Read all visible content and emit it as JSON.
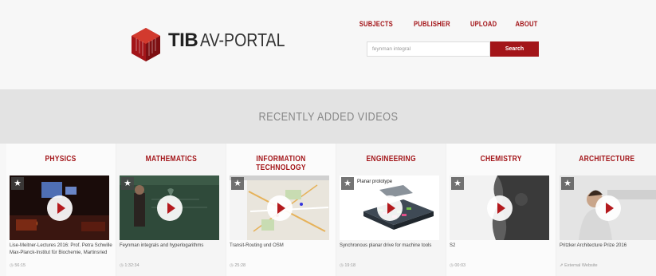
{
  "header": {
    "logo_bold": "TIB",
    "logo_light": "AV-PORTAL",
    "nav": [
      "SUBJECTS",
      "PUBLISHER",
      "UPLOAD",
      "ABOUT"
    ],
    "search": {
      "value": "feynman integral",
      "button": "Search"
    }
  },
  "band": {
    "title": "RECENTLY ADDED VIDEOS"
  },
  "colors": {
    "accent": "#a31519",
    "band": "#e3e3e3"
  },
  "categories": [
    {
      "name": "PHYSICS",
      "video_title": "Lise-Meitner-Lectures 2016: Prof. Petra Schwille Max-Planck-Institut für Biochemie, Martinsried",
      "meta": "56:15",
      "meta_icon": "clock-icon"
    },
    {
      "name": "MATHEMATICS",
      "video_title": "Feynman integrals and hyperlogarithms",
      "meta": "1:32:34",
      "meta_icon": "clock-icon"
    },
    {
      "name": "INFORMATION TECHNOLOGY",
      "video_title": "Transit-Routing und OSM",
      "meta": "25:28",
      "meta_icon": "clock-icon"
    },
    {
      "name": "ENGINEERING",
      "video_title": "Synchronous planar drive for machine tools",
      "meta": "19:18",
      "meta_icon": "clock-icon"
    },
    {
      "name": "CHEMISTRY",
      "video_title": "S2",
      "meta": "00:03",
      "meta_icon": "clock-icon"
    },
    {
      "name": "ARCHITECTURE",
      "video_title": "Pritzker Architecture Prize 2016",
      "meta": "External Website",
      "meta_icon": "external-link-icon"
    }
  ],
  "thumb_labels": {
    "engineering": "Planar prototype"
  }
}
